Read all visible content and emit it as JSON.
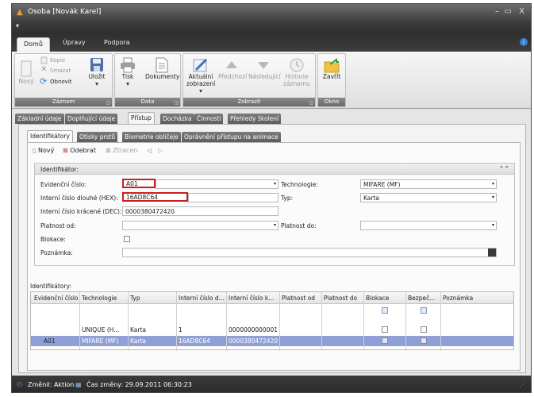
{
  "window": {
    "title": "Osoba [Novák Karel]",
    "controls": {
      "minimize": "–",
      "restore": "▭",
      "close": "X"
    },
    "qat_arrow": "▾"
  },
  "ribbon_tabs": [
    "Domů",
    "Úpravy",
    "Podpora"
  ],
  "help_icon": "i",
  "ribbon": {
    "novy": "Nový",
    "kopie": "Kopie",
    "smazat": "Smazat",
    "obnovit": "Obnovit",
    "ulozit": "Uložit",
    "group_zaznam": "Záznam",
    "tisk": "Tisk",
    "dokumenty": "Dokumenty",
    "group_data": "Data",
    "aktualni_line1": "Aktuální",
    "aktualni_line2": "zobrazení ▾",
    "predchozi": "Předchozí",
    "nasledujici": "Následující",
    "historie_line1": "Historie",
    "historie_line2": "záznamu",
    "group_zobrazit": "Zobrazit",
    "zavrit": "Zavřít",
    "group_okno": "Okno"
  },
  "main_tabs": [
    "Základní údaje",
    "Doplňující údaje",
    "Přístup",
    "Docházka",
    "Činnosti",
    "Přehledy školení"
  ],
  "sub_tabs": [
    "Identifikátory",
    "Otisky prstů",
    "Biometrie obličeje",
    "Oprávnění přístupu na animace"
  ],
  "toolbar": {
    "novy": "Nový",
    "odebrat": "Odebrat",
    "ztracen": "Ztracen"
  },
  "identifikator": {
    "header": "Identifikátor:",
    "collapse": "⌃⌃",
    "evidencni_label": "Evidenční číslo:",
    "evidencni_value": "A01",
    "technologie_label": "Technologie:",
    "technologie_value": "MIFARE (MF)",
    "hex_label": "Interní číslo dlouhé (HEX):",
    "hex_value": "16AD8C64",
    "typ_label": "Typ:",
    "typ_value": "Karta",
    "dec_label": "Interní číslo krácené (DEC):",
    "dec_value": "0000380472420",
    "platnost_od_label": "Platnost od:",
    "platnost_do_label": "Platnost do:",
    "blokace_label": "Blokace:",
    "poznamka_label": "Poznámka:"
  },
  "grid": {
    "label": "Identifikátory:",
    "columns": [
      "Evidenční číslo",
      "Technologie",
      "Typ",
      "Interní číslo d...",
      "Interní číslo k...",
      "Platnost od",
      "Platnost do",
      "Blokace",
      "Bezpeč...",
      "Poznámka"
    ],
    "rows": [
      [
        "",
        "UNIQUE (H...",
        "Karta",
        "1",
        "0000000000001",
        "",
        "",
        "",
        "",
        ""
      ],
      [
        "A01",
        "MIFARE (MF)",
        "Karta",
        "16AD8C64",
        "0000380472420",
        "",
        "",
        "",
        "",
        ""
      ]
    ]
  },
  "status": {
    "changed_by": "Změnil: Aktion",
    "changed_time": "Čas změny: 29.09.2011 06:30:23"
  },
  "colors": {
    "highlight": "#c81e1e",
    "selected_row": "#8fa0d6",
    "accent": "#3b7fd6"
  }
}
